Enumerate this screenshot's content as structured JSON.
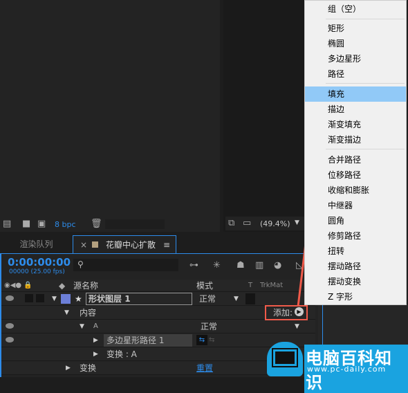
{
  "project_panel": {
    "bpc": "8 bpc"
  },
  "viewer": {
    "zoom": "(49.4%)"
  },
  "tabs": [
    {
      "label": "渲染队列"
    },
    {
      "label": "花瓣中心扩散",
      "close": "×",
      "menu": "≡"
    }
  ],
  "timeline": {
    "timecode": "0:00:00:00",
    "frame_info": "00000 (25.00 fps)",
    "columns": {
      "source_name": "源名称",
      "mode": "模式",
      "t": "T",
      "trkmat": "TrkMat"
    },
    "layer": {
      "name": "形状图层",
      "index": "1",
      "mode": "正常",
      "label_color": "#6c7fd8"
    },
    "contents": "内容",
    "add_label": "添加:",
    "group": {
      "name": "A",
      "mode": "正常"
    },
    "path": {
      "name": "多边星形路径",
      "index": "1"
    },
    "group_transform": "变换 : A",
    "transform": "变换",
    "reset": "重置"
  },
  "add_menu": {
    "items": [
      "组（空）",
      "矩形",
      "椭圆",
      "多边星形",
      "路径",
      "填充",
      "描边",
      "渐变填充",
      "渐变描边",
      "合并路径",
      "位移路径",
      "收缩和膨胀",
      "中继器",
      "圆角",
      "修剪路径",
      "扭转",
      "摆动路径",
      "摆动变换",
      "Z 字形"
    ],
    "highlighted": "填充"
  },
  "watermark": {
    "title": "电脑百科知识",
    "url": "www.pc-daily.com"
  },
  "colors": {
    "accent": "#2d8ceb",
    "highlight": "#91c9f7",
    "annotation": "#f05a4a"
  }
}
